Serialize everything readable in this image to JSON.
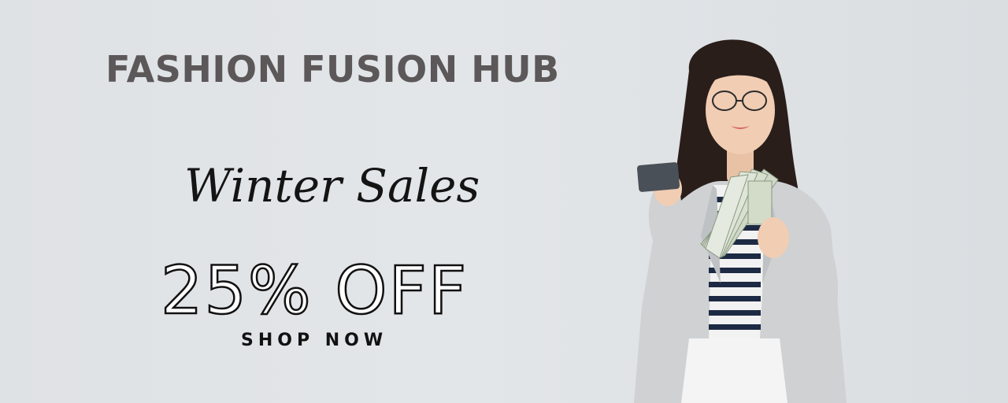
{
  "banner": {
    "brand": "FASHION FUSION HUB",
    "sale_title": "Winter Sales",
    "discount": "25% OFF",
    "cta": "SHOP NOW"
  },
  "photo": {
    "description_icon": "woman-holding-card-and-cash-photo"
  },
  "colors": {
    "background": "#e1e4e7",
    "brand_text": "#5c5758",
    "text_dark": "#111111"
  }
}
